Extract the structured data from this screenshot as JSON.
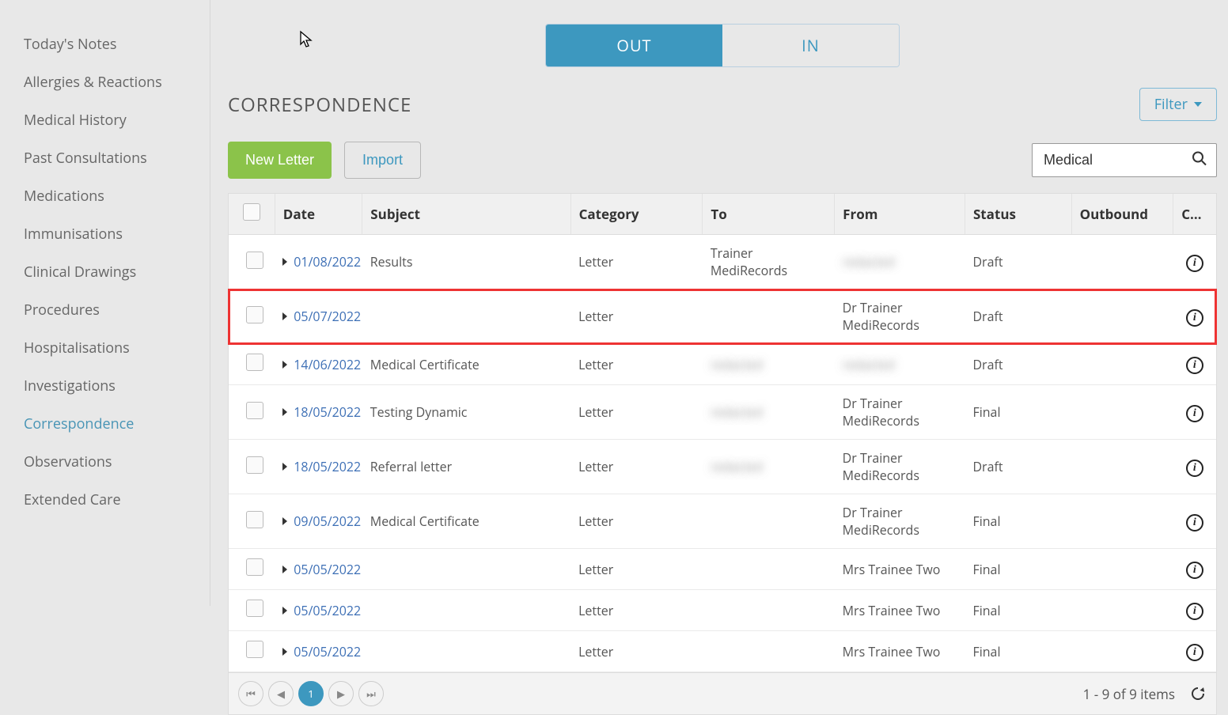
{
  "sidebar": {
    "items": [
      {
        "label": "Today's Notes",
        "active": false
      },
      {
        "label": "Allergies & Reactions",
        "active": false
      },
      {
        "label": "Medical History",
        "active": false
      },
      {
        "label": "Past Consultations",
        "active": false
      },
      {
        "label": "Medications",
        "active": false
      },
      {
        "label": "Immunisations",
        "active": false
      },
      {
        "label": "Clinical Drawings",
        "active": false
      },
      {
        "label": "Procedures",
        "active": false
      },
      {
        "label": "Hospitalisations",
        "active": false
      },
      {
        "label": "Investigations",
        "active": false
      },
      {
        "label": "Correspondence",
        "active": true
      },
      {
        "label": "Observations",
        "active": false
      },
      {
        "label": "Extended Care",
        "active": false
      }
    ]
  },
  "tabs": {
    "out": "OUT",
    "in": "IN",
    "active": "out"
  },
  "heading": "CORRESPONDENCE",
  "filter_label": "Filter",
  "actions": {
    "new_letter": "New Letter",
    "import": "Import"
  },
  "search": {
    "value": "Medical"
  },
  "columns": {
    "date": "Date",
    "subject": "Subject",
    "category": "Category",
    "to": "To",
    "from": "From",
    "status": "Status",
    "outbound": "Outbound",
    "co": "Co..."
  },
  "rows": [
    {
      "date": "01/08/2022",
      "subject": "Results",
      "category": "Letter",
      "to": "Trainer MediRecords",
      "from": "redacted",
      "status": "Draft",
      "highlight": false,
      "to_blur": false,
      "from_blur": true
    },
    {
      "date": "05/07/2022",
      "subject": "",
      "category": "Letter",
      "to": "",
      "from": "Dr Trainer MediRecords",
      "status": "Draft",
      "highlight": true,
      "to_blur": false,
      "from_blur": false
    },
    {
      "date": "14/06/2022",
      "subject": "Medical Certificate",
      "category": "Letter",
      "to": "redacted",
      "from": "redacted",
      "status": "Draft",
      "highlight": false,
      "to_blur": true,
      "from_blur": true
    },
    {
      "date": "18/05/2022",
      "subject": "Testing Dynamic",
      "category": "Letter",
      "to": "redacted",
      "from": "Dr Trainer MediRecords",
      "status": "Final",
      "highlight": false,
      "to_blur": true,
      "from_blur": false
    },
    {
      "date": "18/05/2022",
      "subject": "Referral letter",
      "category": "Letter",
      "to": "redacted",
      "from": "Dr Trainer MediRecords",
      "status": "Draft",
      "highlight": false,
      "to_blur": true,
      "from_blur": false
    },
    {
      "date": "09/05/2022",
      "subject": "Medical Certificate",
      "category": "Letter",
      "to": "",
      "from": "Dr Trainer MediRecords",
      "status": "Final",
      "highlight": false,
      "to_blur": false,
      "from_blur": false
    },
    {
      "date": "05/05/2022",
      "subject": "",
      "category": "Letter",
      "to": "",
      "from": "Mrs Trainee Two",
      "status": "Final",
      "highlight": false,
      "to_blur": false,
      "from_blur": false
    },
    {
      "date": "05/05/2022",
      "subject": "",
      "category": "Letter",
      "to": "",
      "from": "Mrs Trainee Two",
      "status": "Final",
      "highlight": false,
      "to_blur": false,
      "from_blur": false
    },
    {
      "date": "05/05/2022",
      "subject": "",
      "category": "Letter",
      "to": "",
      "from": "Mrs Trainee Two",
      "status": "Final",
      "highlight": false,
      "to_blur": false,
      "from_blur": false
    }
  ],
  "pager": {
    "current": "1",
    "summary": "1 - 9 of 9 items"
  }
}
